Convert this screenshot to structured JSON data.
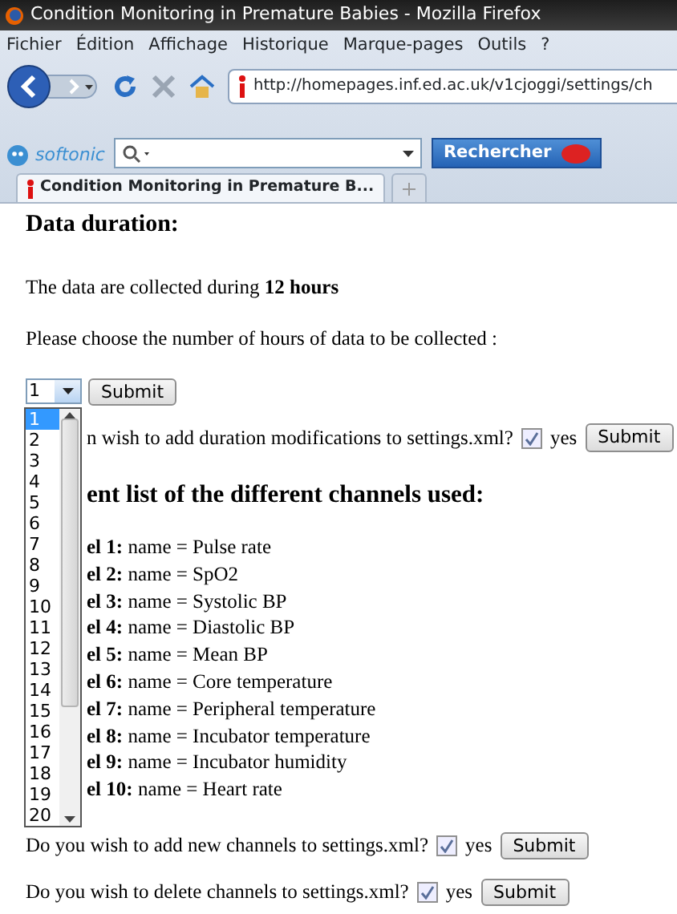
{
  "window": {
    "title": "Condition Monitoring in Premature Babies - Mozilla Firefox"
  },
  "menu": [
    "Fichier",
    "Édition",
    "Affichage",
    "Historique",
    "Marque-pages",
    "Outils",
    "?"
  ],
  "address": {
    "url": "http://homepages.inf.ed.ac.uk/v1cjoggi/settings/ch"
  },
  "search_bar": {
    "brand": "softonic",
    "button": "Rechercher"
  },
  "tabs": [
    {
      "label": "Condition Monitoring in Premature B...",
      "selected": true
    }
  ],
  "page": {
    "heading": "Data duration:",
    "collected": "The data are collected during **12 hours**",
    "prompt": "Please choose the number of hours of data to be collected :",
    "select": {
      "value": "1",
      "submit": "Submit"
    },
    "dropdown": [
      {
        "label": "1",
        "selected": true
      },
      {
        "label": "2",
        "selected": false
      },
      {
        "label": "3",
        "selected": false
      },
      {
        "label": "4",
        "selected": false
      },
      {
        "label": "5",
        "selected": false
      },
      {
        "label": "6",
        "selected": false
      },
      {
        "label": "7",
        "selected": false
      },
      {
        "label": "8",
        "selected": false
      },
      {
        "label": "9",
        "selected": false
      },
      {
        "label": "10",
        "selected": false
      },
      {
        "label": "11",
        "selected": false
      },
      {
        "label": "12",
        "selected": false
      },
      {
        "label": "13",
        "selected": false
      },
      {
        "label": "14",
        "selected": false
      },
      {
        "label": "15",
        "selected": false
      },
      {
        "label": "16",
        "selected": false
      },
      {
        "label": "17",
        "selected": false
      },
      {
        "label": "18",
        "selected": false
      },
      {
        "label": "19",
        "selected": false
      },
      {
        "label": "20",
        "selected": false
      }
    ],
    "duration_question": {
      "text": "n wish to add duration modifications to settings.xml?",
      "checked": true,
      "yes": "yes",
      "submit": "Submit"
    },
    "channels_heading": "ent list of the different channels used:",
    "channels": [
      {
        "label": "el 1:",
        "text": "name = Pulse rate"
      },
      {
        "label": "el 2:",
        "text": "name = SpO2"
      },
      {
        "label": "el 3:",
        "text": "name = Systolic BP"
      },
      {
        "label": "el 4:",
        "text": "name = Diastolic BP"
      },
      {
        "label": "el 5:",
        "text": "name = Mean BP"
      },
      {
        "label": "el 6:",
        "text": "name = Core temperature"
      },
      {
        "label": "el 7:",
        "text": "name = Peripheral temperature"
      },
      {
        "label": "el 8:",
        "text": "name = Incubator temperature"
      },
      {
        "label": "el 9:",
        "text": "name = Incubator humidity"
      },
      {
        "label": "el 10:",
        "text": "name = Heart rate"
      }
    ],
    "questions": [
      {
        "text": "Do you wish to add new channels to settings.xml?",
        "checked": true,
        "yes": "yes",
        "submit": "Submit"
      },
      {
        "text": "Do you wish to delete channels to settings.xml?",
        "checked": true,
        "yes": "yes",
        "submit": "Submit"
      }
    ]
  }
}
